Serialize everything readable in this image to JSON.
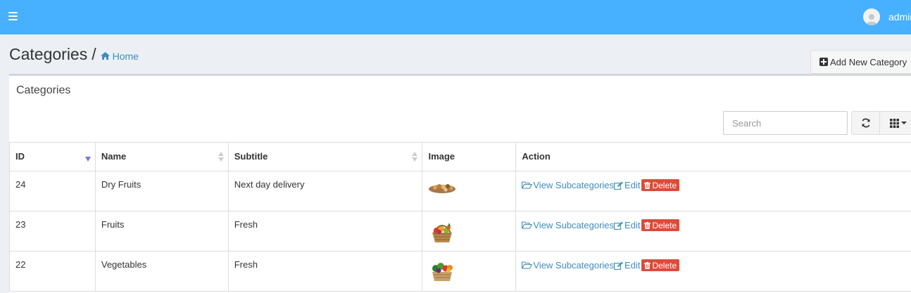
{
  "header": {
    "username": "admin",
    "bar_color": "#47b0ff"
  },
  "page": {
    "title": "Categories",
    "separator": "/",
    "breadcrumb_home": "Home",
    "add_button_label": "Add New Category"
  },
  "box": {
    "title": "Categories",
    "search_placeholder": "Search"
  },
  "table": {
    "columns": [
      "ID",
      "Name",
      "Subtitle",
      "Image",
      "Action"
    ],
    "sorted_column": "ID",
    "sort_direction": "desc",
    "rows": [
      {
        "id": "24",
        "name": "Dry Fruits",
        "subtitle": "Next day delivery",
        "image": "dry-fruits-thumbnail"
      },
      {
        "id": "23",
        "name": "Fruits",
        "subtitle": "Fresh",
        "image": "fruit-basket-thumbnail"
      },
      {
        "id": "22",
        "name": "Vegetables",
        "subtitle": "Fresh",
        "image": "vegetable-basket-thumbnail"
      }
    ],
    "actions": {
      "view": "View Subcategories",
      "edit": "Edit",
      "delete": "Delete"
    }
  },
  "colors": {
    "link": "#3c8dbc",
    "danger": "#dd4b39"
  }
}
